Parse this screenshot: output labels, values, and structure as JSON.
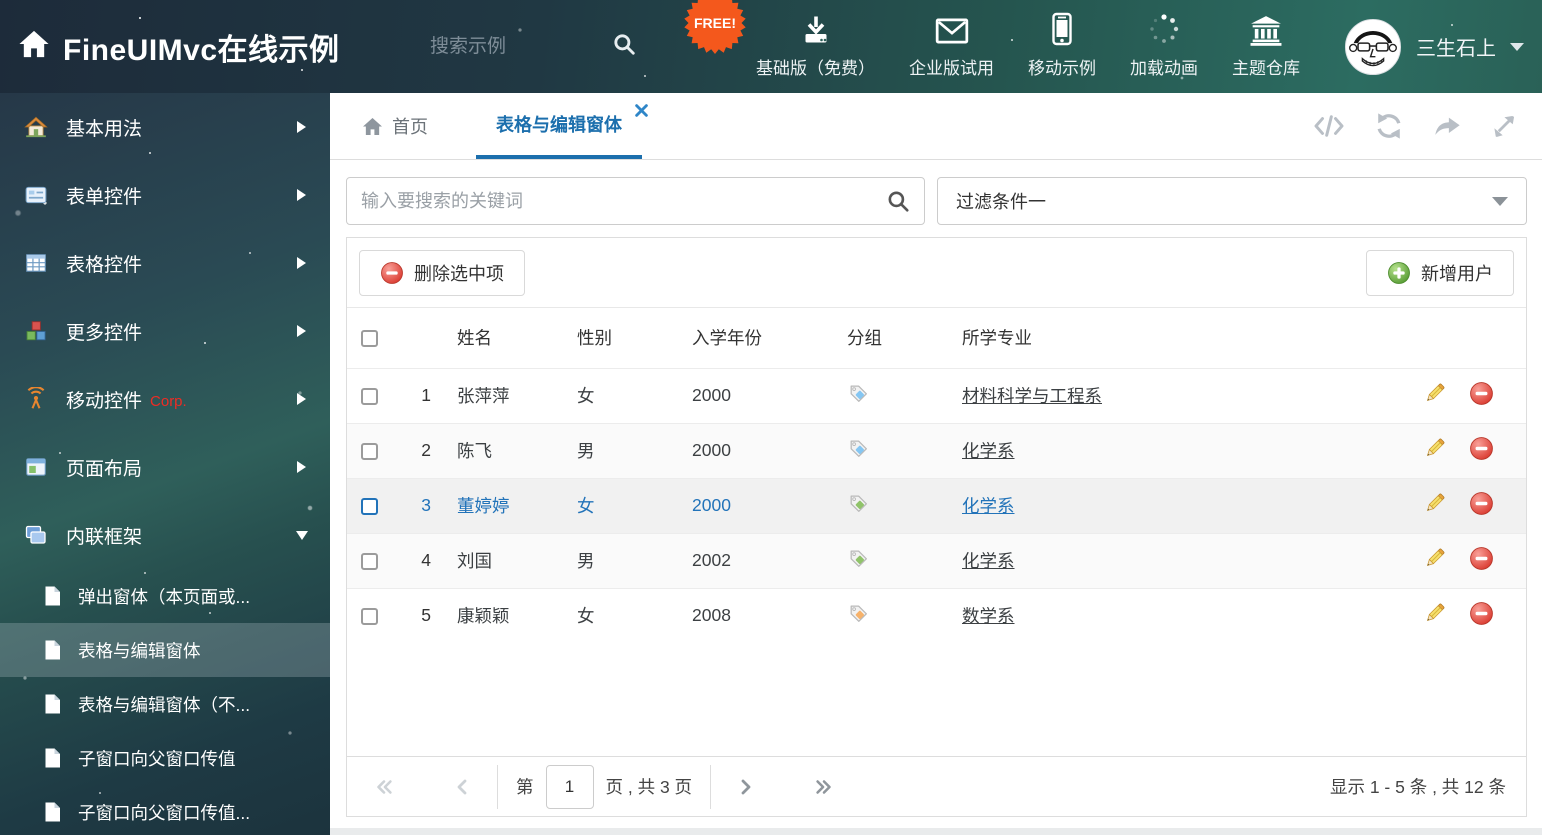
{
  "colors": {
    "accent_blue": "#2273b9",
    "danger_red": "#e25449",
    "success_green": "#5fad3f",
    "header_teal": "#2d6f64",
    "badge_orange": "#f4581c"
  },
  "header": {
    "title": "FineUIMvc在线示例",
    "search_placeholder": "搜索示例",
    "free_badge": "FREE!",
    "nav_items": [
      {
        "icon": "download-icon",
        "label": "基础版（免费）"
      },
      {
        "icon": "envelope-icon",
        "label": "企业版试用"
      },
      {
        "icon": "phone-icon",
        "label": "移动示例"
      },
      {
        "icon": "spinner-icon",
        "label": "加载动画"
      },
      {
        "icon": "bank-icon",
        "label": "主题仓库"
      }
    ],
    "user_name": "三生石上"
  },
  "sidebar": {
    "items": [
      {
        "icon": "house-icon",
        "label": "基本用法"
      },
      {
        "icon": "form-icon",
        "label": "表单控件"
      },
      {
        "icon": "grid-icon",
        "label": "表格控件"
      },
      {
        "icon": "cubes-icon",
        "label": "更多控件"
      },
      {
        "icon": "signal-icon",
        "label": "移动控件",
        "badge": "Corp."
      },
      {
        "icon": "layout-icon",
        "label": "页面布局"
      },
      {
        "icon": "frames-icon",
        "label": "内联框架",
        "expanded": true
      }
    ],
    "subitems": [
      {
        "label": "弹出窗体（本页面或..."
      },
      {
        "label": "表格与编辑窗体",
        "selected": true
      },
      {
        "label": "表格与编辑窗体（不..."
      },
      {
        "label": "子窗口向父窗口传值"
      },
      {
        "label": "子窗口向父窗口传值..."
      }
    ]
  },
  "tabs": [
    {
      "label": "首页"
    },
    {
      "label": "表格与编辑窗体",
      "active": true,
      "closable": true
    }
  ],
  "filter": {
    "search_placeholder": "输入要搜索的关键词",
    "selected_filter": "过滤条件一"
  },
  "toolbar": {
    "delete_label": "删除选中项",
    "add_label": "新增用户"
  },
  "table": {
    "columns": [
      "姓名",
      "性别",
      "入学年份",
      "分组",
      "所学专业"
    ],
    "rows": [
      {
        "num": "1",
        "name": "张萍萍",
        "gender": "女",
        "year": "2000",
        "tag_color": "#85c6f2",
        "major": "材料科学与工程系"
      },
      {
        "num": "2",
        "name": "陈飞",
        "gender": "男",
        "year": "2000",
        "tag_color": "#85c6f2",
        "major": "化学系"
      },
      {
        "num": "3",
        "name": "董婷婷",
        "gender": "女",
        "year": "2000",
        "tag_color": "#90c36a",
        "major": "化学系",
        "selected": true
      },
      {
        "num": "4",
        "name": "刘国",
        "gender": "男",
        "year": "2002",
        "tag_color": "#90c36a",
        "major": "化学系"
      },
      {
        "num": "5",
        "name": "康颖颖",
        "gender": "女",
        "year": "2008",
        "tag_color": "#f6b26b",
        "major": "数学系"
      }
    ]
  },
  "pagination": {
    "page_prefix": "第",
    "page_value": "1",
    "page_suffix": "页 , 共 3 页",
    "summary": "显示 1 - 5 条 , 共 12 条"
  }
}
